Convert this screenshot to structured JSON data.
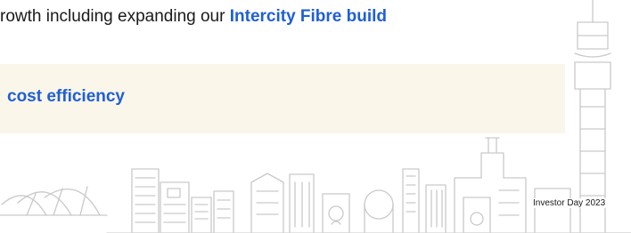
{
  "slide": {
    "line1_prefix": "rowth including expanding our ",
    "line1_highlight": "Intercity Fibre build",
    "banner_text": "cost efficiency",
    "footer_label": "Investor Day 2023"
  },
  "colors": {
    "highlight": "#1f5fd6",
    "banner_bg": "#fbf6ea",
    "line_art": "#c9c9c9"
  },
  "icons": [
    "sydney-skyline-illustration"
  ]
}
